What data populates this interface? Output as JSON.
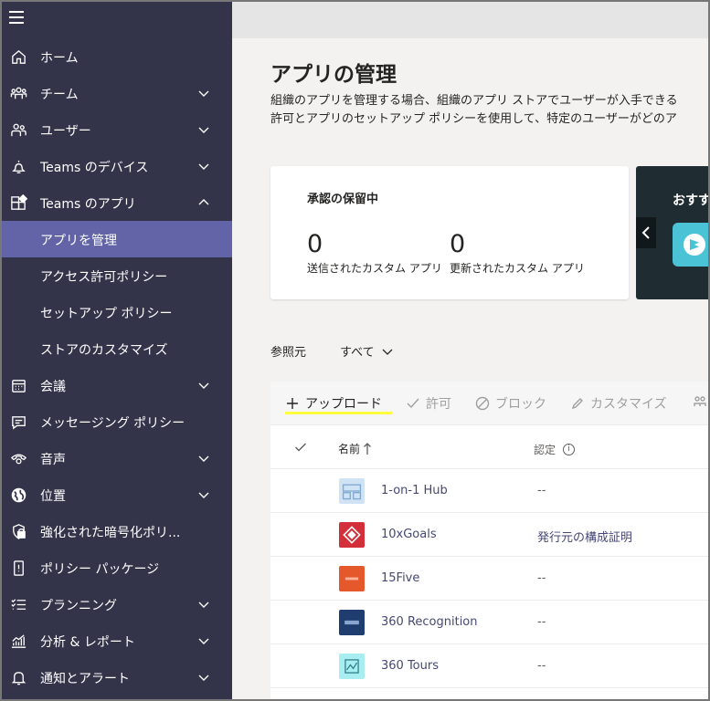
{
  "sidebar": {
    "items": [
      {
        "label": "ホーム",
        "icon": "home-icon"
      },
      {
        "label": "チーム",
        "icon": "teams-icon"
      },
      {
        "label": "ユーザー",
        "icon": "users-icon"
      },
      {
        "label": "Teams のデバイス",
        "icon": "bell-device-icon"
      },
      {
        "label": "Teams のアプリ",
        "icon": "apps-icon"
      },
      {
        "label": "アプリを管理"
      },
      {
        "label": "アクセス許可ポリシー"
      },
      {
        "label": "セットアップ ポリシー"
      },
      {
        "label": "ストアのカスタマイズ"
      },
      {
        "label": "会議",
        "icon": "calendar-icon"
      },
      {
        "label": "メッセージング ポリシー",
        "icon": "chat-icon"
      },
      {
        "label": "音声",
        "icon": "phone-icon"
      },
      {
        "label": "位置",
        "icon": "globe-icon"
      },
      {
        "label": "強化された暗号化ポリ...",
        "icon": "lock-icon"
      },
      {
        "label": "ポリシー パッケージ",
        "icon": "package-icon"
      },
      {
        "label": "プランニング",
        "icon": "checklist-icon"
      },
      {
        "label": "分析 & レポート",
        "icon": "analytics-icon"
      },
      {
        "label": "通知とアラート",
        "icon": "bell-icon"
      }
    ]
  },
  "main": {
    "title": "アプリの管理",
    "description_line1": "組織のアプリを管理する場合、組織のアプリ ストアでユーザーが入手できる",
    "description_line2": "許可とアプリのセットアップ ポリシーを使用して、特定のユーザーがどのア"
  },
  "pending": {
    "title": "承認の保留中",
    "submitted_count": "0",
    "submitted_label": "送信されたカスタム アプリ",
    "updated_count": "0",
    "updated_label": "更新されたカスタム アプリ"
  },
  "promo": {
    "title": "おすす"
  },
  "filter": {
    "label": "参照元",
    "value": "すべて"
  },
  "toolbar": {
    "upload": "アップロード",
    "allow": "許可",
    "block": "ブロック",
    "customize": "カスタマイズ"
  },
  "table": {
    "col_name": "名前",
    "col_cert": "認定",
    "rows": [
      {
        "name": "1-on-1 Hub",
        "cert": "--",
        "color": "#cfe3f5"
      },
      {
        "name": "10xGoals",
        "cert": "発行元の構成証明",
        "color": "#d32f3b"
      },
      {
        "name": "15Five",
        "cert": "--",
        "color": "#e5582b"
      },
      {
        "name": "360 Recognition",
        "cert": "--",
        "color": "#1f3d6e"
      },
      {
        "name": "360 Tours",
        "cert": "--",
        "color": "#a8eef0"
      }
    ]
  },
  "colors": {
    "sidebar_bg": "#33344a",
    "active_item": "#6264a7",
    "link": "#464775",
    "highlight": "#ffff3b"
  }
}
